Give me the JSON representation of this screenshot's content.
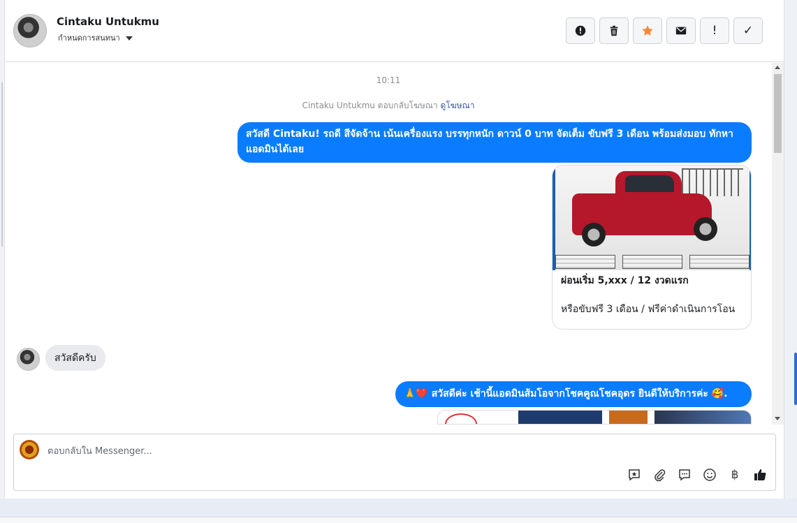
{
  "header": {
    "name": "Cintaku Untukmu",
    "subtitle": "กำหนดการสนทนา",
    "toolbar": [
      {
        "name": "mark-spam-button",
        "icon": "alert-circle-icon"
      },
      {
        "name": "delete-button",
        "icon": "trash-icon"
      },
      {
        "name": "star-button",
        "icon": "star-icon",
        "color": "#f5883a"
      },
      {
        "name": "mark-unread-button",
        "icon": "envelope-icon"
      },
      {
        "name": "follow-up-button",
        "icon": "exclamation-icon",
        "glyph": "!"
      },
      {
        "name": "mark-done-button",
        "icon": "check-icon",
        "glyph": "✓"
      }
    ]
  },
  "thread": {
    "time": "10:11",
    "context_prefix": "Cintaku Untukmu ตอบกลับโฆษณา",
    "context_link": "ดูโฆษณา",
    "messages": [
      {
        "text": "สวัสดี Cintaku! รถดี สีจัดจ้าน เน้นเครื่องแรง บรรทุกหนัก ดาวน์ 0 บาท จัดเต็ม ขับฟรี 3 เดือน พร้อมส่งมอบ ทักหาแอดมินได้เลย"
      },
      {
        "card_title": "ผ่อนเริ่ม 5,xxx / 12 งวดแรก",
        "card_desc": "หรือขับฟรี 3 เดือน / ฟรีค่าดำเนินการโอน"
      },
      {
        "text": "สวัสดีครับ"
      },
      {
        "text": "🙏❤️ สวัสดีค่ะ เช้านี้แอดมินส้มโอจากโชคคูณโชคอุดร ยินดีให้บริการค่ะ 🥰."
      }
    ]
  },
  "composer": {
    "placeholder": "ตอบกลับใน Messenger...",
    "tools": [
      "saved-reply-icon",
      "paperclip-icon",
      "chat-bubble-icon",
      "smiley-icon",
      "baht-icon",
      "thumbs-up-icon"
    ],
    "baht_glyph": "฿"
  },
  "colors": {
    "outgoing": "#0a7cff",
    "incoming": "#e9eaed",
    "star": "#f5883a",
    "link": "#385898"
  }
}
